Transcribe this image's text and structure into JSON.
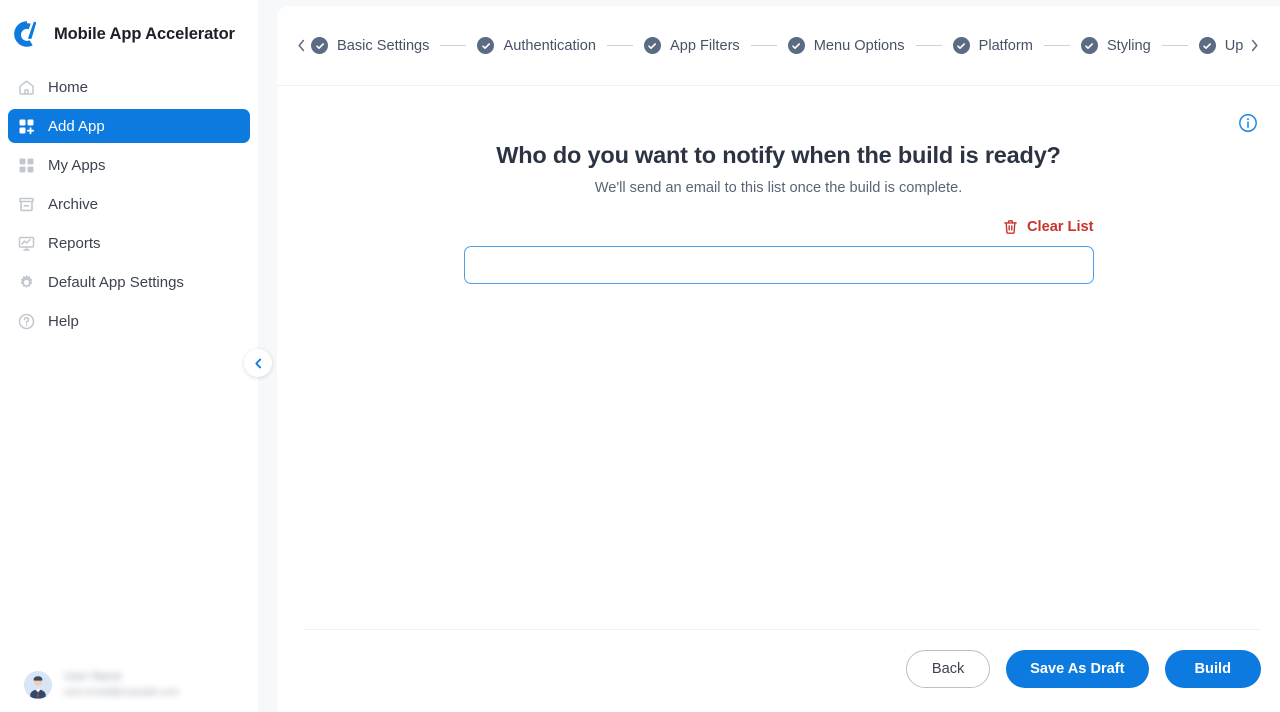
{
  "brand": {
    "title": "Mobile App Accelerator",
    "logo_icon": "app-accelerator-logo"
  },
  "sidebar": {
    "collapse_icon": "chevron-left-icon",
    "items": [
      {
        "label": "Home",
        "icon": "home-icon",
        "active": false
      },
      {
        "label": "Add App",
        "icon": "grid-plus-icon",
        "active": true
      },
      {
        "label": "My Apps",
        "icon": "grid-icon",
        "active": false
      },
      {
        "label": "Archive",
        "icon": "archive-icon",
        "active": false
      },
      {
        "label": "Reports",
        "icon": "report-monitor-icon",
        "active": false
      },
      {
        "label": "Default App Settings",
        "icon": "gear-icon",
        "active": false
      },
      {
        "label": "Help",
        "icon": "question-circle-icon",
        "active": false
      }
    ],
    "user": {
      "name_redacted": "User Name",
      "email_redacted": "user.email@example.com",
      "avatar_icon": "avatar-icon"
    }
  },
  "stepper": {
    "prev_icon": "chevron-left-icon",
    "next_icon": "chevron-right-icon",
    "steps": [
      {
        "label": "Basic Settings",
        "state": "complete",
        "icon": "check-circle-icon"
      },
      {
        "label": "Authentication",
        "state": "complete",
        "icon": "check-circle-icon"
      },
      {
        "label": "App Filters",
        "state": "complete",
        "icon": "check-circle-icon"
      },
      {
        "label": "Menu Options",
        "state": "complete",
        "icon": "check-circle-icon"
      },
      {
        "label": "Platform",
        "state": "complete",
        "icon": "check-circle-icon"
      },
      {
        "label": "Styling",
        "state": "complete",
        "icon": "check-circle-icon"
      },
      {
        "label": "Uploa",
        "state": "complete",
        "icon": "check-circle-icon"
      }
    ]
  },
  "main": {
    "info_icon": "info-circle-icon",
    "title": "Who do you want to notify when the build is ready?",
    "subtitle": "We'll send an email to this list once the build is complete.",
    "clear_list": {
      "label": "Clear List",
      "icon": "trash-icon"
    },
    "email_input": {
      "value": "",
      "placeholder": ""
    }
  },
  "footer": {
    "back_label": "Back",
    "save_draft_label": "Save As Draft",
    "build_label": "Build"
  },
  "colors": {
    "accent_blue": "#0d7ae0",
    "step_slate": "#5c6b84",
    "danger_red": "#c7342e",
    "panel_bg": "#ffffff",
    "app_bg": "#f7f8fa",
    "input_border": "#4f9fe8"
  }
}
